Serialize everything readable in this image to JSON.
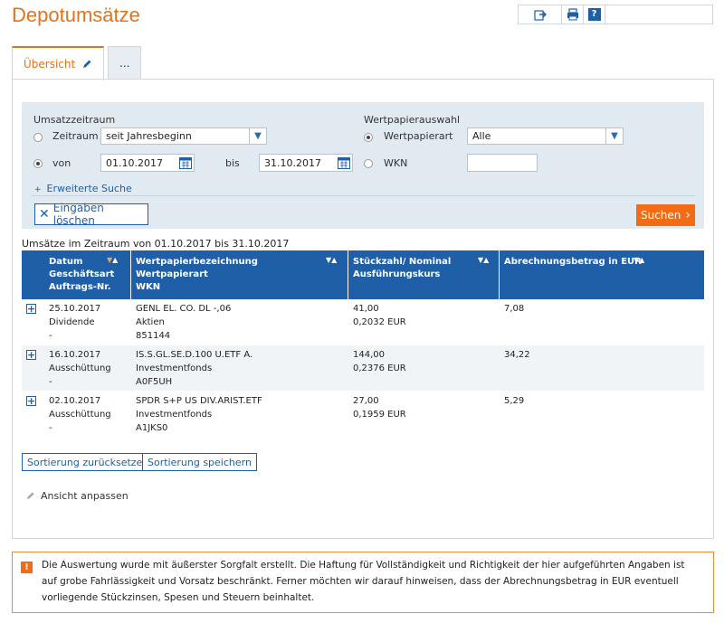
{
  "page": {
    "title": "Depotumsätze"
  },
  "toolbar": {
    "export_icon": "export-icon",
    "print_icon": "print-icon",
    "help_icon": "help-icon"
  },
  "tabs": [
    {
      "label": "Übersicht",
      "active": true
    },
    {
      "label": "...",
      "active": false
    }
  ],
  "search": {
    "period_heading": "Umsatzzeitraum",
    "zeitraum_label": "Zeitraum",
    "zeitraum_value": "seit Jahresbeginn",
    "von_label": "von",
    "von_value": "01.10.2017",
    "bis_label": "bis",
    "bis_value": "31.10.2017",
    "selection_heading": "Wertpapierauswahl",
    "wertpapierart_label": "Wertpapierart",
    "wertpapierart_value": "Alle",
    "wkn_label": "WKN",
    "wkn_value": "",
    "advanced_link": "Erweiterte Suche",
    "clear_label": "Eingaben löschen",
    "search_label": "Suchen"
  },
  "results": {
    "range_text": "Umsätze im Zeitraum von 01.10.2017 bis 31.10.2017",
    "columns": {
      "c1": [
        "Datum",
        "Geschäftsart",
        "Auftrags-Nr."
      ],
      "c2": [
        "Wertpapierbezeichnung",
        "Wertpapierart",
        "WKN"
      ],
      "c3": [
        "Stückzahl/ Nominal",
        "Ausführungskurs"
      ],
      "c4": [
        "Abrechnungsbetrag in EUR"
      ]
    },
    "rows": [
      {
        "date": "25.10.2017",
        "type": "Dividende",
        "order": "-",
        "name": "GENL EL. CO. DL -,06",
        "kind": "Aktien",
        "wkn": "851144",
        "qty": "41,00",
        "price": "0,2032 EUR",
        "amount": "7,08"
      },
      {
        "date": "16.10.2017",
        "type": "Ausschüttung",
        "order": "-",
        "name": "IS.S.GL.SE.D.100 U.ETF A.",
        "kind": "Investmentfonds",
        "wkn": "A0F5UH",
        "qty": "144,00",
        "price": "0,2376 EUR",
        "amount": "34,22"
      },
      {
        "date": "02.10.2017",
        "type": "Ausschüttung",
        "order": "-",
        "name": "SPDR S+P US DIV.ARIST.ETF",
        "kind": "Investmentfonds",
        "wkn": "A1JKS0",
        "qty": "27,00",
        "price": "0,1959 EUR",
        "amount": "5,29"
      }
    ],
    "reset_sort_label": "Sortierung zurücksetzen",
    "save_sort_label": "Sortierung speichern",
    "adjust_view_label": "Ansicht anpassen"
  },
  "notice": {
    "text": "Die Auswertung wurde mit äußerster Sorgfalt erstellt. Die Haftung für Vollständigkeit und Richtigkeit der hier aufgeführten Angaben ist auf grobe Fahrlässigkeit und Vorsatz beschränkt. Ferner möchten wir darauf hinweisen, dass der Abrechnungsbetrag in EUR eventuell vorliegende Stückzinsen, Spesen und Steuern beinhaltet."
  },
  "colors": {
    "accent": "#e0741c",
    "primary": "#1f5fa8",
    "search_bg": "#e1e9f1"
  }
}
